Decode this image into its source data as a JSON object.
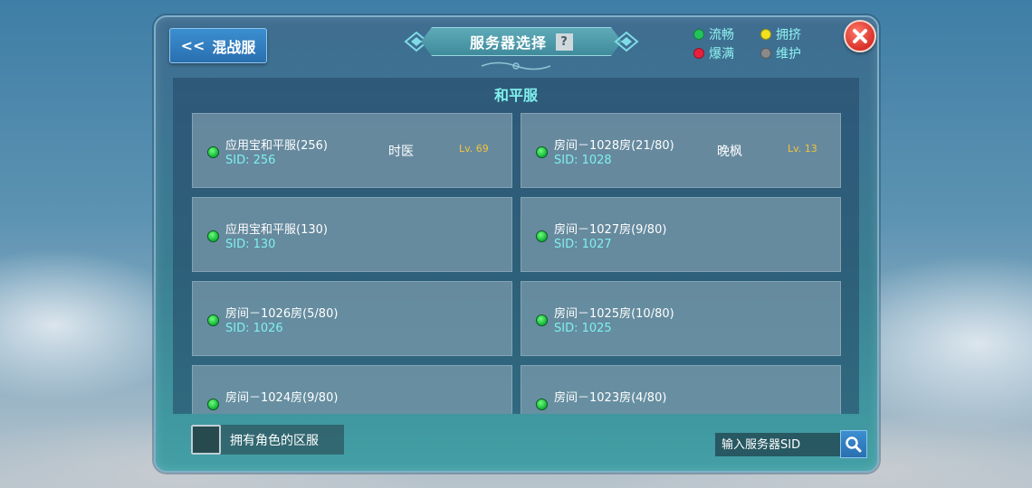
{
  "header": {
    "back_arrow": "<<",
    "back_label": "混战服",
    "title": "服务器选择",
    "help": "?"
  },
  "legend": [
    {
      "label": "流畅",
      "color": "#22c35a"
    },
    {
      "label": "拥挤",
      "color": "#f2e21e"
    },
    {
      "label": "爆满",
      "color": "#e8203c"
    },
    {
      "label": "维护",
      "color": "#8a8a8a"
    }
  ],
  "close_icon": "close-icon",
  "section": {
    "title": "和平服"
  },
  "servers": [
    {
      "name": "应用宝和平服(256)",
      "sid": "SID: 256",
      "role": "时医",
      "level": "Lv. 69"
    },
    {
      "name": "房间－1028房(21/80)",
      "sid": "SID: 1028",
      "role": "晚枫",
      "level": "Lv. 13"
    },
    {
      "name": "应用宝和平服(130)",
      "sid": "SID: 130",
      "role": "",
      "level": ""
    },
    {
      "name": "房间－1027房(9/80)",
      "sid": "SID: 1027",
      "role": "",
      "level": ""
    },
    {
      "name": "房间－1026房(5/80)",
      "sid": "SID: 1026",
      "role": "",
      "level": ""
    },
    {
      "name": "房间－1025房(10/80)",
      "sid": "SID: 1025",
      "role": "",
      "level": ""
    },
    {
      "name": "房间－1024房(9/80)",
      "sid": "",
      "role": "",
      "level": ""
    },
    {
      "name": "房间－1023房(4/80)",
      "sid": "",
      "role": "",
      "level": ""
    }
  ],
  "footer": {
    "owned_label": "拥有角色的区服",
    "search_placeholder": "输入服务器SID"
  }
}
